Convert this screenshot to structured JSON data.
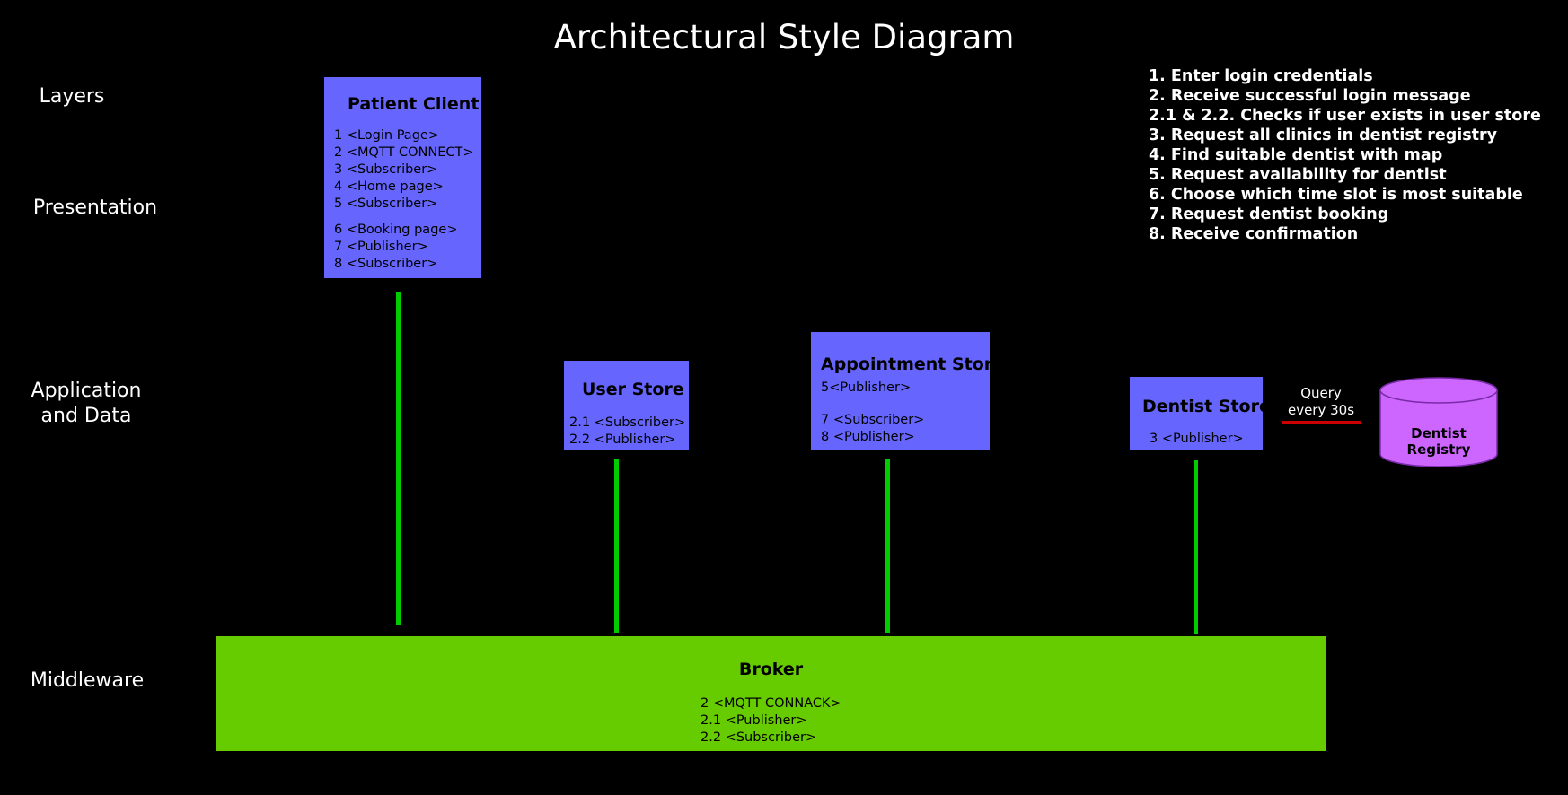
{
  "title": "Architectural Style Diagram",
  "layers": {
    "header": "Layers",
    "presentation": "Presentation",
    "application_line1": "Application",
    "application_line2": "and Data",
    "middleware": "Middleware"
  },
  "steps": [
    "1. Enter login credentials",
    "2. Receive successful login message",
    "2.1 & 2.2. Checks if user exists in user store",
    "3. Request all clinics in dentist registry",
    "4. Find suitable dentist with map",
    "5. Request availability for dentist",
    "6. Choose which time slot is most suitable",
    "7. Request dentist booking",
    "8. Receive confirmation"
  ],
  "patient_client": {
    "title": "Patient Client",
    "lines_a": [
      "1 <Login Page>",
      "2 <MQTT CONNECT>",
      "3 <Subscriber>",
      "4 <Home page>",
      "5 <Subscriber>"
    ],
    "lines_b": [
      "6 <Booking page>",
      "7 <Publisher>",
      "8 <Subscriber>"
    ]
  },
  "user_store": {
    "title": "User Store",
    "lines": [
      "2.1 <Subscriber>",
      "2.2 <Publisher>"
    ]
  },
  "appointment_store": {
    "title": "Appointment Store",
    "lines_a": [
      "5<Publisher>"
    ],
    "lines_b": [
      "7 <Subscriber>",
      "8 <Publisher>"
    ]
  },
  "dentist_store": {
    "title": "Dentist Store",
    "lines": [
      "3 <Publisher>"
    ]
  },
  "broker": {
    "title": "Broker",
    "lines": [
      "2 <MQTT CONNACK>",
      "2.1 <Publisher>",
      "2.2 <Subscriber>"
    ]
  },
  "query": {
    "line1": "Query",
    "line2": "every 30s"
  },
  "registry": {
    "label": "Dentist Registry"
  },
  "colors": {
    "background": "#000000",
    "node": "#6666ff",
    "broker": "#66cc00",
    "connector": "#00cc00",
    "query_line": "#cc0000",
    "registry": "#cc66ff"
  }
}
